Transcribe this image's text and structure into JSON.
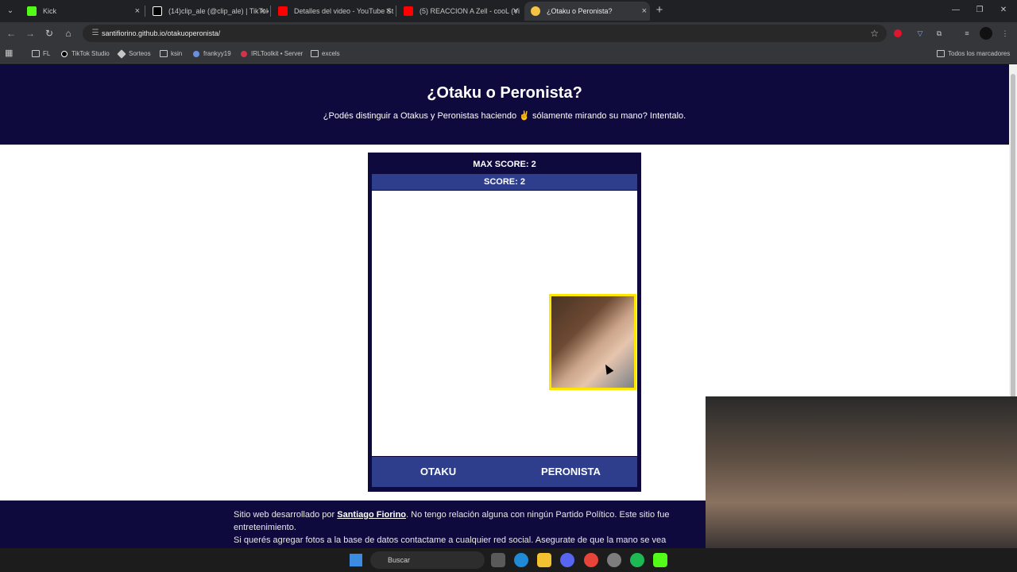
{
  "browser": {
    "tabs": [
      {
        "label": "Kick",
        "color": "#53fc18"
      },
      {
        "label": "(14)clip_ale (@clip_ale) | TikTok",
        "color": "#ffffff"
      },
      {
        "label": "Detalles del video - YouTube St",
        "color": "#ff0000"
      },
      {
        "label": "(5) REACCION A Zell - cooL (Vi",
        "color": "#ff0000"
      },
      {
        "label": "¿Otaku o Peronista?",
        "color": "#f4c542"
      }
    ],
    "url": "santifiorino.github.io/otakuoperonista/",
    "bookmarks": [
      "FL",
      "TikTok Studio",
      "Sorteos",
      "ksin",
      "frankyy19",
      "IRLToolkit • Server",
      "excels"
    ],
    "all_bookmarks": "Todos los marcadores"
  },
  "page": {
    "title": "¿Otaku o Peronista?",
    "subtitle": "¿Podés distinguir a Otakus y Peronistas haciendo ✌ sólamente mirando su mano? Intentalo."
  },
  "game": {
    "max_score": "MAX SCORE: 2",
    "score": "SCORE: 2",
    "otaku_label": "OTAKU",
    "peronista_label": "PERONISTA"
  },
  "footer": {
    "line1_prefix": "Sitio web desarrollado por ",
    "author": "Santiago Fiorino",
    "line1_suffix": ". No tengo relación alguna con ningún Partido Político. Este sitio fue",
    "line2": "entretenimiento.",
    "line3": "Si querés agregar fotos a la base de datos contactame a cualquier red social. Asegurate de que la mano se vea"
  },
  "taskbar": {
    "search_label": "Buscar"
  }
}
